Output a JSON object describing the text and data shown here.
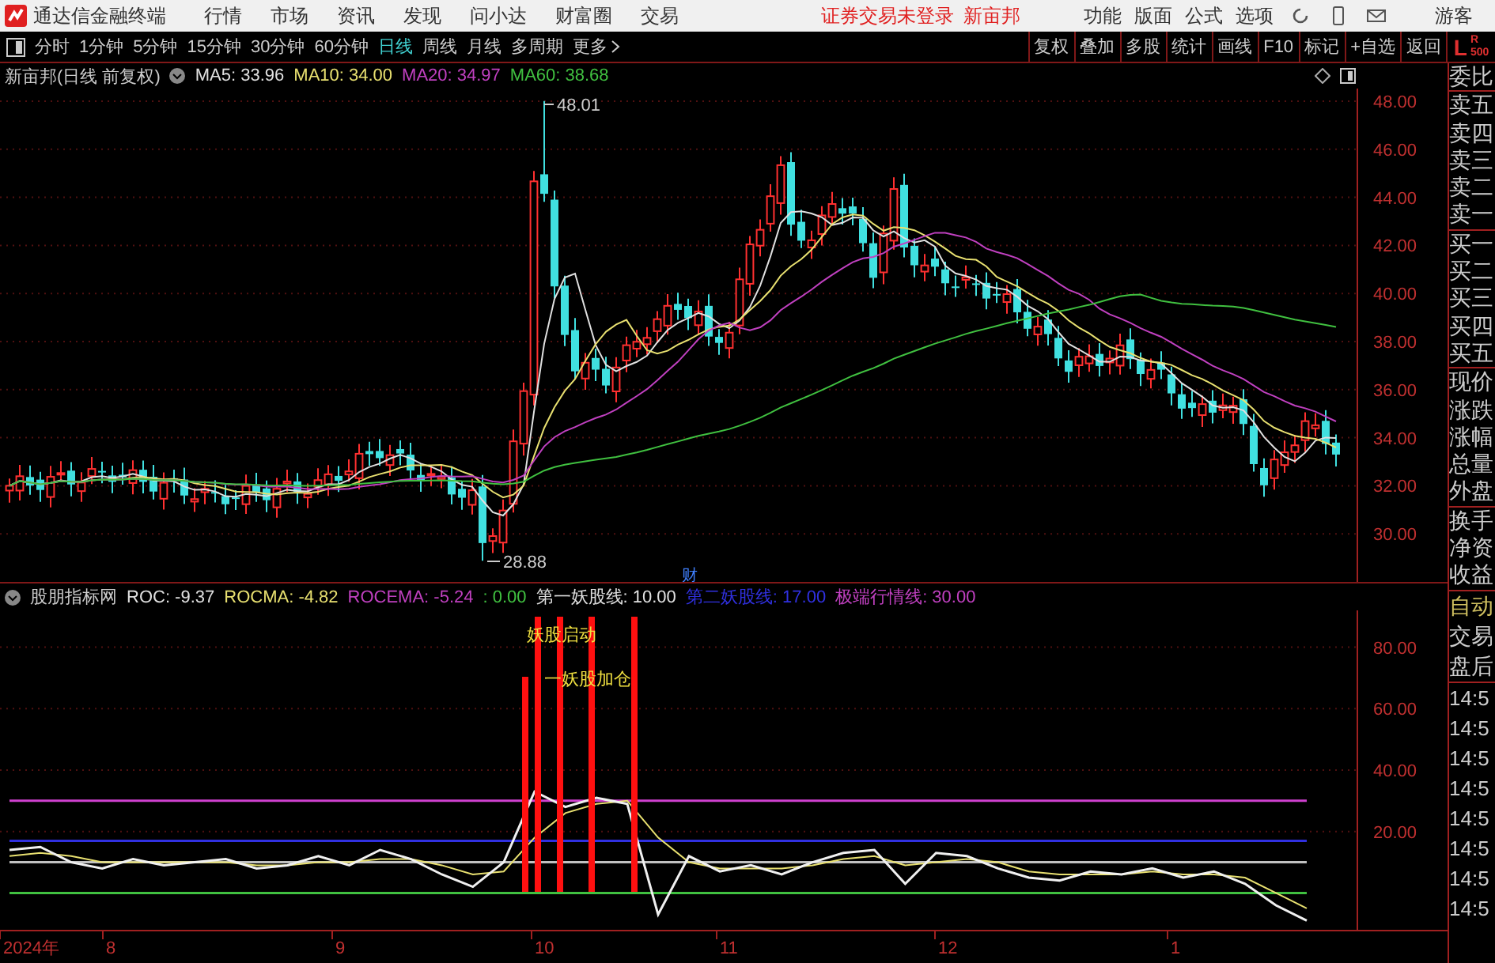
{
  "app": {
    "title": "通达信金融终端"
  },
  "menu": [
    "行情",
    "市场",
    "资讯",
    "发现",
    "问小达",
    "财富圈",
    "交易"
  ],
  "notices": [
    "证券交易未登录",
    "新亩邦"
  ],
  "right_menu": [
    "功能",
    "版面",
    "公式",
    "选项"
  ],
  "user": "游客",
  "periods": [
    {
      "label": "分时",
      "selected": false
    },
    {
      "label": "1分钟",
      "selected": false
    },
    {
      "label": "5分钟",
      "selected": false
    },
    {
      "label": "15分钟",
      "selected": false
    },
    {
      "label": "30分钟",
      "selected": false
    },
    {
      "label": "60分钟",
      "selected": false
    },
    {
      "label": "日线",
      "selected": true
    },
    {
      "label": "周线",
      "selected": false
    },
    {
      "label": "月线",
      "selected": false
    },
    {
      "label": "多周期",
      "selected": false
    },
    {
      "label": "更多",
      "selected": false
    }
  ],
  "tools": [
    "复权",
    "叠加",
    "多股",
    "统计",
    "画线",
    "F10",
    "标记",
    "+自选",
    "返回"
  ],
  "level_badge": {
    "main": "L",
    "sup": "R",
    "sub": "500"
  },
  "price_chart": {
    "title": "新亩邦(日线 前复权)",
    "ma": [
      {
        "label": "MA5: 33.96",
        "color": "#e0e0e0"
      },
      {
        "label": "MA10: 34.00",
        "color": "#e8e070"
      },
      {
        "label": "MA20: 34.97",
        "color": "#c040c0"
      },
      {
        "label": "MA60: 38.68",
        "color": "#40c040"
      }
    ],
    "y_axis": [
      "48.00",
      "46.00",
      "44.00",
      "42.00",
      "40.00",
      "38.00",
      "36.00",
      "34.00",
      "32.00",
      "30.00"
    ],
    "high_label": "48.01",
    "low_label": "28.88",
    "marker": "财"
  },
  "indicator": {
    "name": "股朋指标网",
    "values": [
      {
        "label": "ROC: -9.37",
        "color": "#e0e0e0"
      },
      {
        "label": "ROCMA: -4.82",
        "color": "#e8e070"
      },
      {
        "label": "ROCEMA: -5.24",
        "color": "#c040c0"
      },
      {
        "label": ": 0.00",
        "color": "#40c040"
      },
      {
        "label": "第一妖股线: 10.00",
        "color": "#e0e0e0"
      },
      {
        "label": "第二妖股线: 17.00",
        "color": "#3030e0"
      },
      {
        "label": "极端行情线: 30.00",
        "color": "#c040c0"
      }
    ],
    "signals": [
      "妖股启动",
      "一妖股加仓"
    ],
    "chart_data": {
      "type": "line",
      "ylim": [
        -12,
        92
      ],
      "grid": true,
      "yticks": [
        {
          "value": 80,
          "label": "80.00"
        },
        {
          "value": 60,
          "label": "60.00"
        },
        {
          "value": 40,
          "label": "40.00"
        },
        {
          "value": 20,
          "label": "20.00"
        }
      ],
      "series": [
        {
          "color": "#f0f0f0",
          "values": [
            14,
            15,
            10,
            8,
            11,
            9,
            10,
            11,
            8,
            9,
            12,
            9,
            14,
            11,
            6,
            2,
            10,
            33,
            28,
            31,
            29,
            -7,
            12,
            7,
            9,
            6,
            10,
            13,
            14,
            3,
            13,
            12,
            8,
            5,
            4,
            7,
            6,
            8,
            5,
            7,
            3,
            -4,
            -9
          ]
        },
        {
          "color": "#e8e070",
          "values": [
            12,
            13,
            12,
            10,
            10,
            10,
            10,
            10,
            9,
            9,
            10,
            10,
            11,
            11,
            9,
            6,
            7,
            18,
            26,
            29,
            30,
            18,
            10,
            8,
            8,
            8,
            9,
            11,
            12,
            9,
            10,
            11,
            10,
            7,
            6,
            6,
            6,
            7,
            6,
            6,
            5,
            0,
            -5
          ]
        },
        {
          "color": "#d040d0",
          "values": [
            30,
            30,
            30,
            30,
            30,
            30,
            30,
            30,
            30,
            30,
            30,
            30,
            30,
            30,
            30,
            30,
            30,
            30,
            30,
            30,
            30,
            30,
            30,
            30,
            30,
            30,
            30,
            30,
            30,
            30,
            30,
            30,
            30,
            30,
            30,
            30,
            30,
            30,
            30,
            30,
            30,
            30,
            30
          ]
        },
        {
          "color": "#3030e0",
          "values": [
            17,
            17,
            17,
            17,
            17,
            17,
            17,
            17,
            17,
            17,
            17,
            17,
            17,
            17,
            17,
            17,
            17,
            17,
            17,
            17,
            17,
            17,
            17,
            17,
            17,
            17,
            17,
            17,
            17,
            17,
            17,
            17,
            17,
            17,
            17,
            17,
            17,
            17,
            17,
            17,
            17,
            17,
            17
          ]
        },
        {
          "color": "#c0c0c0",
          "values": [
            10,
            10,
            10,
            10,
            10,
            10,
            10,
            10,
            10,
            10,
            10,
            10,
            10,
            10,
            10,
            10,
            10,
            10,
            10,
            10,
            10,
            10,
            10,
            10,
            10,
            10,
            10,
            10,
            10,
            10,
            10,
            10,
            10,
            10,
            10,
            10,
            10,
            10,
            10,
            10,
            10,
            10,
            10
          ]
        },
        {
          "color": "#40c040",
          "values": [
            0,
            0,
            0,
            0,
            0,
            0,
            0,
            0,
            0,
            0,
            0,
            0,
            0,
            0,
            0,
            0,
            0,
            0,
            0,
            0,
            0,
            0,
            0,
            0,
            0,
            0,
            0,
            0,
            0,
            0,
            0,
            0,
            0,
            0,
            0,
            0,
            0,
            0,
            0,
            0,
            0,
            0,
            0
          ]
        }
      ]
    }
  },
  "x_axis": [
    "2024年",
    "8",
    "9",
    "10",
    "11",
    "12",
    "1"
  ],
  "quote_panel": {
    "groups": [
      [
        "委比"
      ],
      [
        "卖五",
        "卖四",
        "卖三",
        "卖二",
        "卖一"
      ],
      [
        "买一",
        "买二",
        "买三",
        "买四",
        "买五"
      ],
      [
        "现价",
        "涨跌",
        "涨幅",
        "总量",
        "外盘"
      ],
      [
        "换手",
        "净资",
        "收益"
      ]
    ],
    "status": [
      "自动",
      "交易",
      "盘后"
    ],
    "times": [
      "14:5",
      "14:5",
      "14:5",
      "14:5",
      "14:5",
      "14:5",
      "14:5",
      "14:5"
    ]
  }
}
